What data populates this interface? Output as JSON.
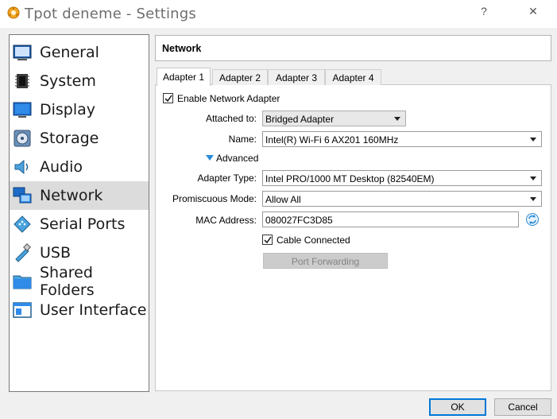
{
  "window": {
    "title": "Tpot deneme - Settings",
    "help_label": "?",
    "close_label": "✕"
  },
  "sidebar": {
    "items": [
      {
        "label": "General",
        "icon": "general-icon"
      },
      {
        "label": "System",
        "icon": "system-icon"
      },
      {
        "label": "Display",
        "icon": "display-icon"
      },
      {
        "label": "Storage",
        "icon": "storage-icon"
      },
      {
        "label": "Audio",
        "icon": "audio-icon"
      },
      {
        "label": "Network",
        "icon": "network-icon",
        "selected": true
      },
      {
        "label": "Serial Ports",
        "icon": "serial-ports-icon"
      },
      {
        "label": "USB",
        "icon": "usb-icon"
      },
      {
        "label": "Shared Folders",
        "icon": "shared-folders-icon"
      },
      {
        "label": "User Interface",
        "icon": "user-interface-icon"
      }
    ]
  },
  "page": {
    "title": "Network",
    "tabs": [
      "Adapter 1",
      "Adapter 2",
      "Adapter 3",
      "Adapter 4"
    ],
    "active_tab": 0
  },
  "form": {
    "enable_adapter": {
      "label": "Enable Network Adapter",
      "checked": true
    },
    "attached_to": {
      "label": "Attached to:",
      "value": "Bridged Adapter"
    },
    "name": {
      "label": "Name:",
      "value": "Intel(R) Wi-Fi 6 AX201 160MHz"
    },
    "advanced": {
      "label": "Advanced",
      "expanded": true
    },
    "adapter_type": {
      "label": "Adapter Type:",
      "value": "Intel PRO/1000 MT Desktop (82540EM)"
    },
    "promiscuous_mode": {
      "label": "Promiscuous Mode:",
      "value": "Allow All"
    },
    "mac_address": {
      "label": "MAC Address:",
      "value": "080027FC3D85"
    },
    "cable_connected": {
      "label": "Cable Connected",
      "checked": true
    },
    "port_forwarding": {
      "label": "Port Forwarding",
      "enabled": false
    }
  },
  "buttons": {
    "ok": "OK",
    "cancel": "Cancel"
  },
  "colors": {
    "accent": "#0078d7",
    "selection": "#dcdcdc",
    "advanced_arrow": "#2a8cd8"
  }
}
